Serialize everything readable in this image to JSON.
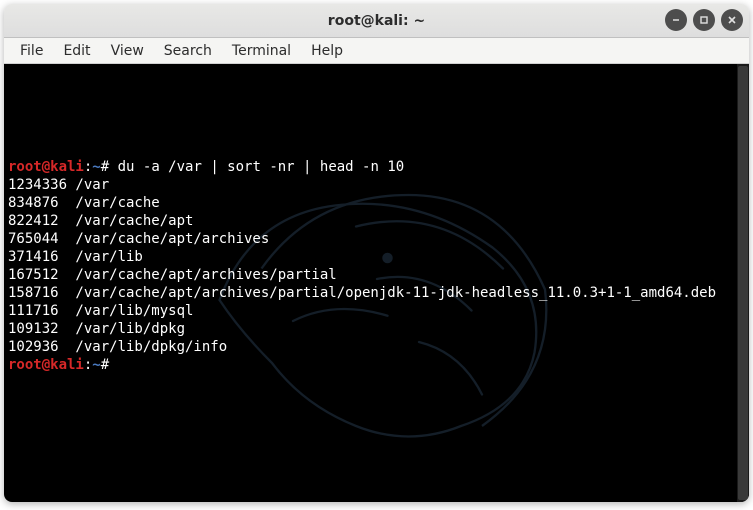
{
  "window": {
    "title": "root@kali: ~"
  },
  "menubar": {
    "items": [
      "File",
      "Edit",
      "View",
      "Search",
      "Terminal",
      "Help"
    ]
  },
  "prompt": {
    "user_host": "root@kali",
    "separator": ":",
    "path": "~",
    "symbol": "#"
  },
  "command": "du -a /var | sort -nr | head -n 10",
  "output": [
    {
      "size": "1234336",
      "path": "/var"
    },
    {
      "size": "834876",
      "path": "/var/cache"
    },
    {
      "size": "822412",
      "path": "/var/cache/apt"
    },
    {
      "size": "765044",
      "path": "/var/cache/apt/archives"
    },
    {
      "size": "371416",
      "path": "/var/lib"
    },
    {
      "size": "167512",
      "path": "/var/cache/apt/archives/partial"
    },
    {
      "size": "158716",
      "path": "/var/cache/apt/archives/partial/openjdk-11-jdk-headless_11.0.3+1-1_amd64.deb"
    },
    {
      "size": "111716",
      "path": "/var/lib/mysql"
    },
    {
      "size": "109132",
      "path": "/var/lib/dpkg"
    },
    {
      "size": "102936",
      "path": "/var/lib/dpkg/info"
    }
  ]
}
